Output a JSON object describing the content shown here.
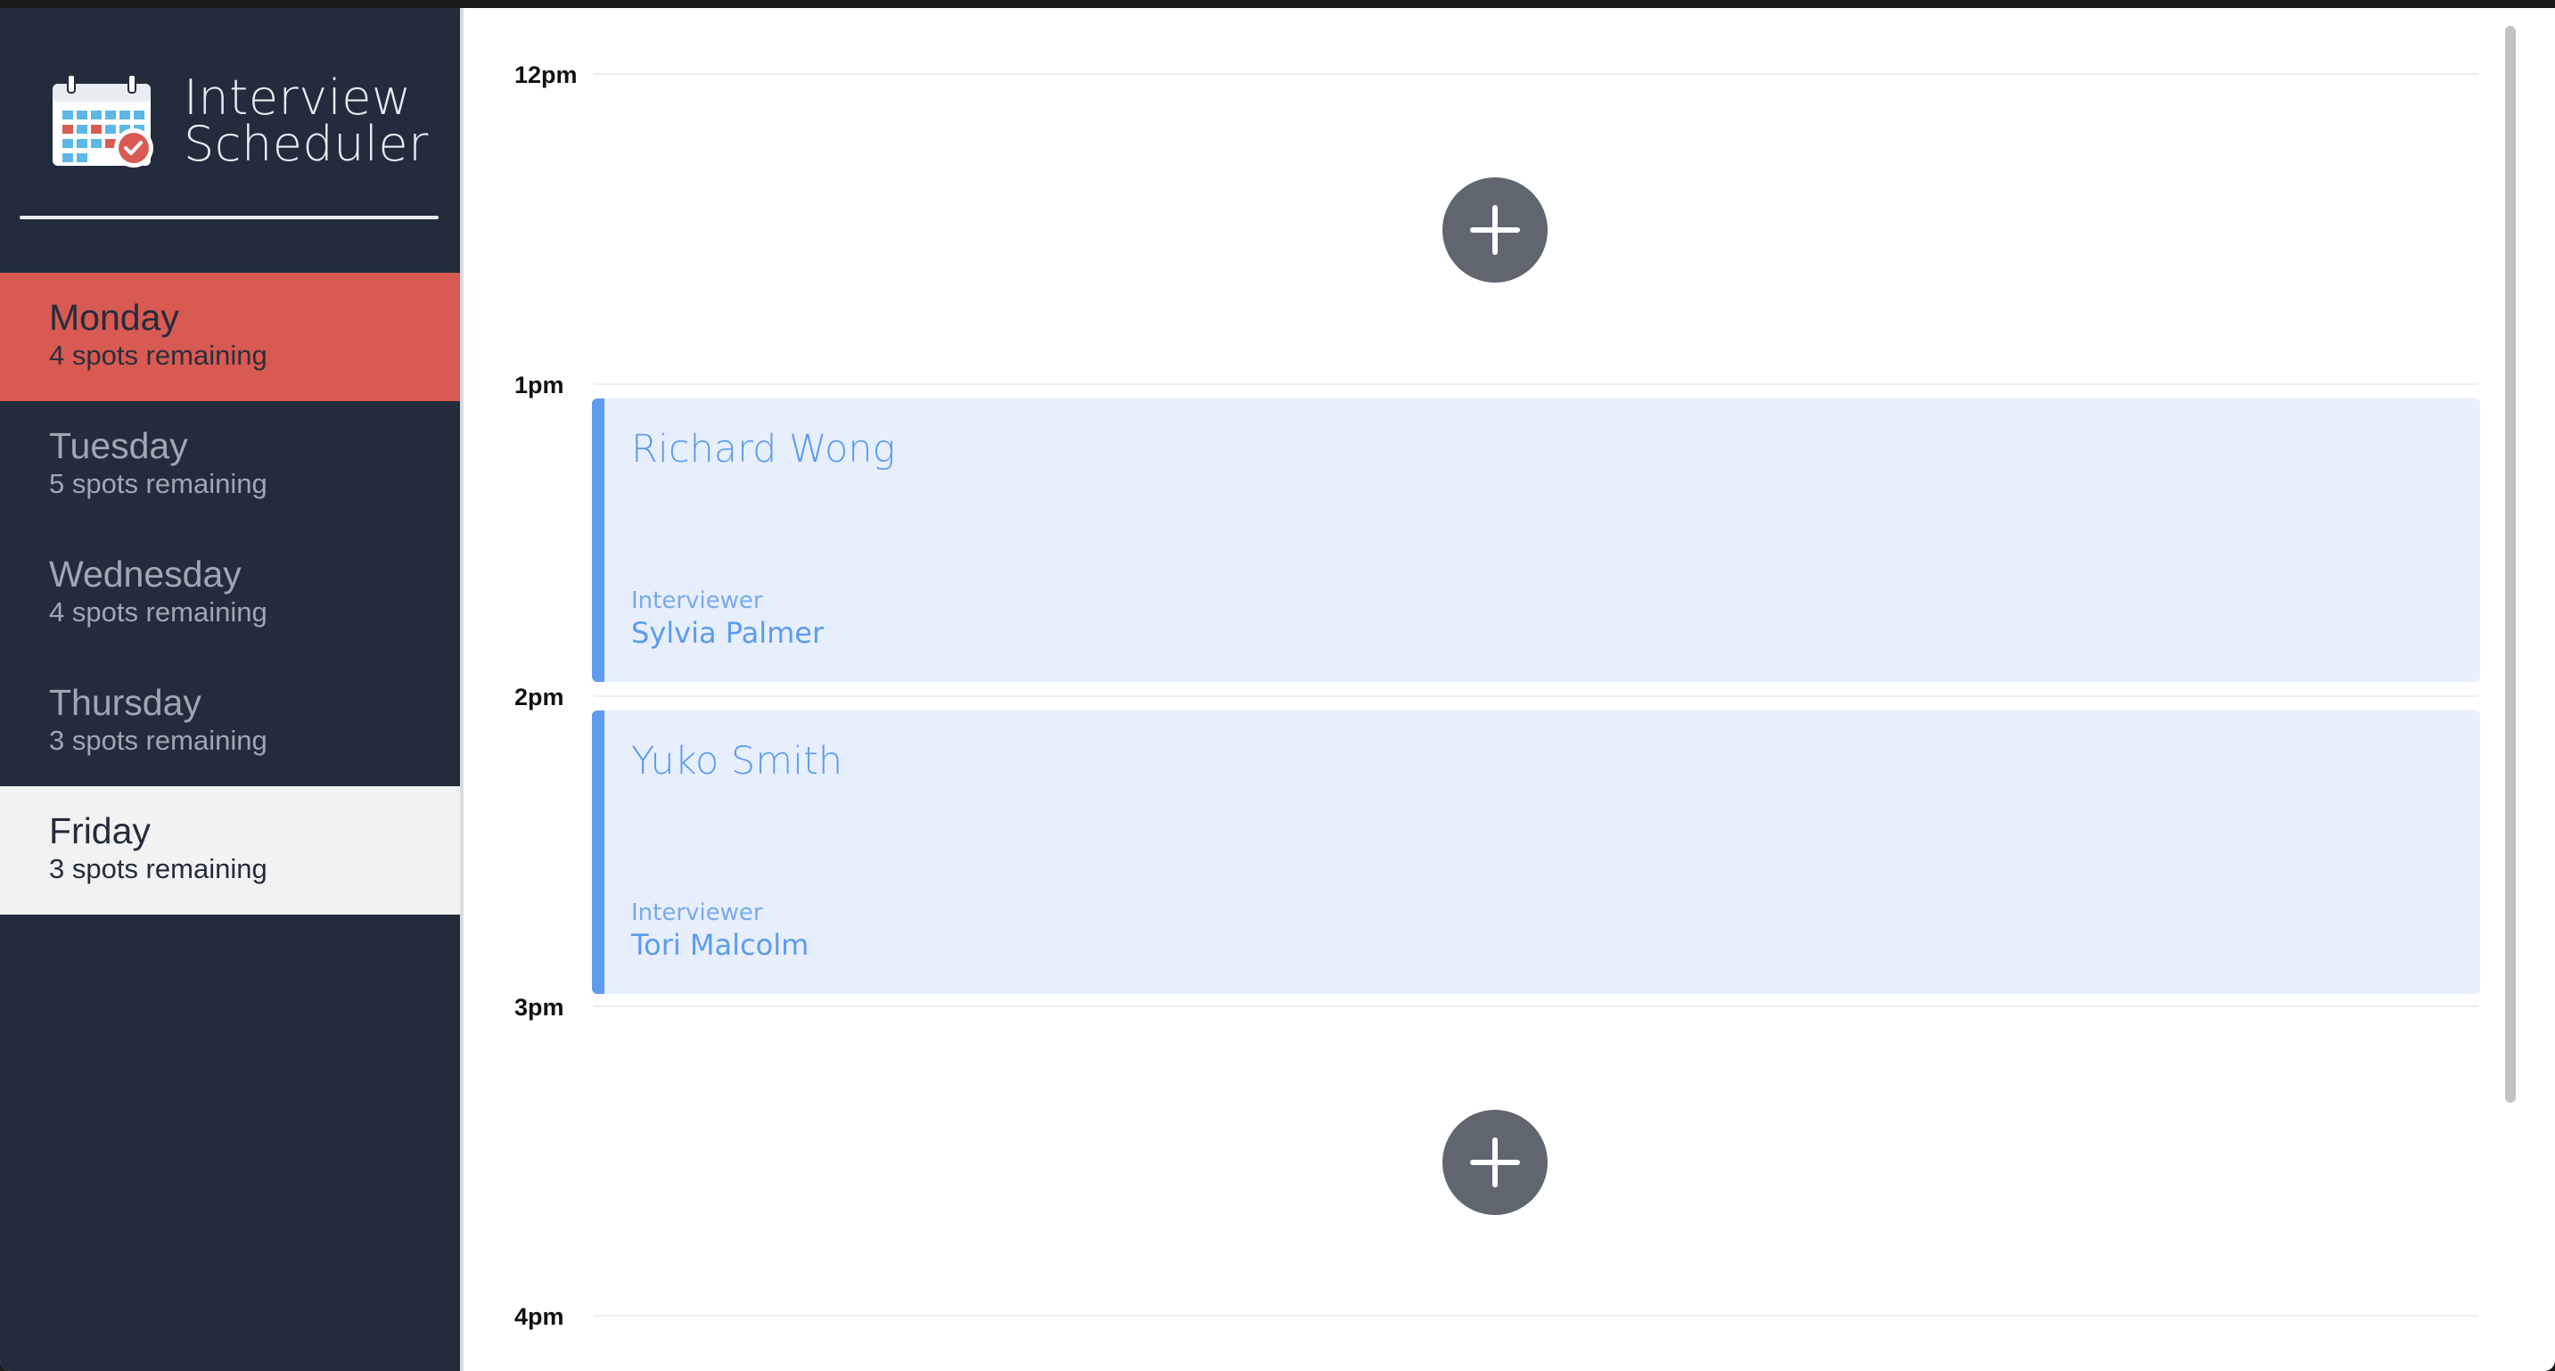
{
  "app": {
    "title_line1": "Interview",
    "title_line2": "Scheduler",
    "logo_icon": "calendar-check-icon"
  },
  "sidebar": {
    "days": [
      {
        "name": "Monday",
        "spots": "4 spots remaining",
        "state": "selected"
      },
      {
        "name": "Tuesday",
        "spots": "5 spots remaining",
        "state": "normal"
      },
      {
        "name": "Wednesday",
        "spots": "4 spots remaining",
        "state": "normal"
      },
      {
        "name": "Thursday",
        "spots": "3 spots remaining",
        "state": "normal"
      },
      {
        "name": "Friday",
        "spots": "3 spots remaining",
        "state": "highlighted"
      }
    ]
  },
  "schedule": {
    "hours": [
      "12pm",
      "1pm",
      "2pm",
      "3pm",
      "4pm"
    ],
    "slots": [
      {
        "time": "12pm",
        "type": "empty",
        "icon": "plus-icon"
      },
      {
        "time": "1pm",
        "type": "booked",
        "student": "Richard Wong",
        "interviewer_label": "Interviewer",
        "interviewer": "Sylvia Palmer"
      },
      {
        "time": "2pm",
        "type": "booked",
        "student": "Yuko Smith",
        "interviewer_label": "Interviewer",
        "interviewer": "Tori Malcolm"
      },
      {
        "time": "3pm",
        "type": "empty",
        "icon": "plus-icon"
      }
    ]
  },
  "colors": {
    "sidebar_bg": "#222c3c",
    "selected_day": "#d95a52",
    "appointment_bg": "#e6effb",
    "appointment_accent": "#5d9bef",
    "add_button": "#5f6670"
  }
}
